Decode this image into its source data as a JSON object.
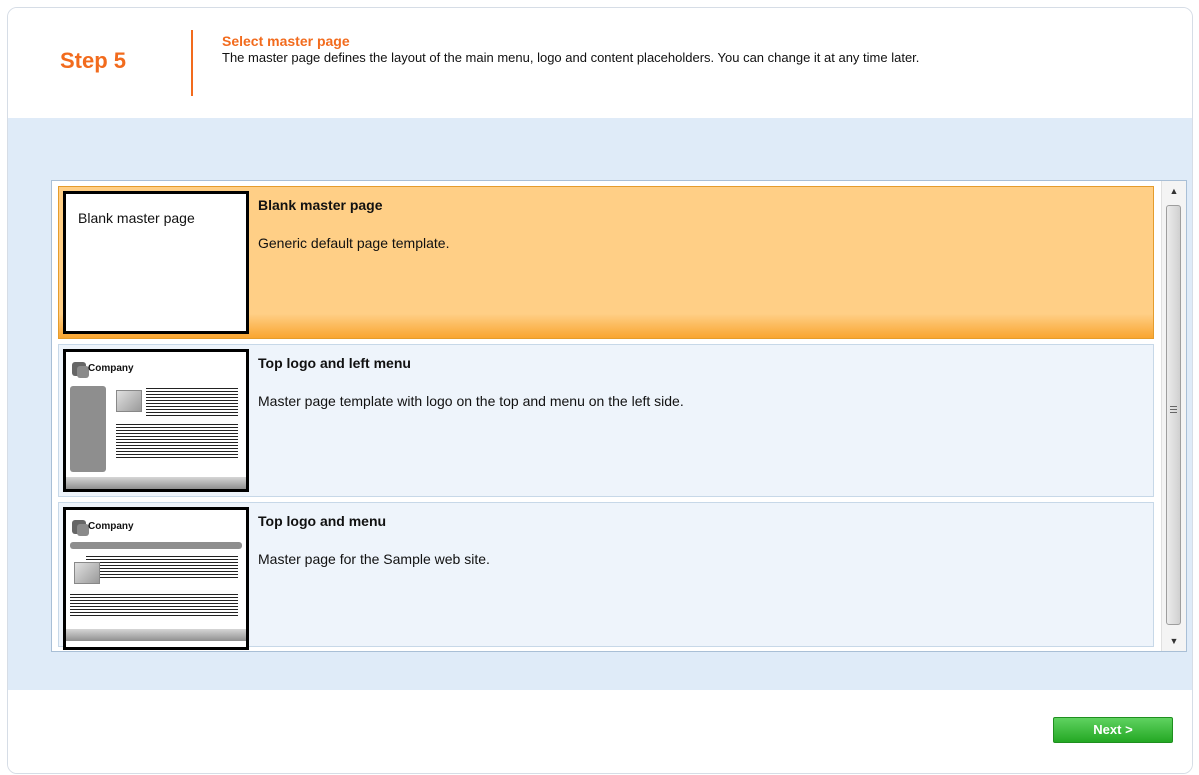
{
  "header": {
    "step": "Step 5",
    "title": "Select master page",
    "description": "The master page defines the layout of the main menu, logo and content placeholders. You can change it at any time later."
  },
  "items": [
    {
      "thumbnail_label": "Blank master page",
      "title": "Blank master page",
      "description": "Generic default page template.",
      "selected": true
    },
    {
      "thumbnail_company": "Company",
      "title": "Top logo and left menu",
      "description": "Master page template with logo on the top and menu on the left side.",
      "selected": false
    },
    {
      "thumbnail_company": "Company",
      "title": "Top logo and menu",
      "description": "Master page for the Sample web site.",
      "selected": false
    }
  ],
  "scrollbar": {
    "up_icon": "▲",
    "down_icon": "▼"
  },
  "footer": {
    "next_label": "Next >"
  },
  "colors": {
    "accent": "#f26b1d",
    "selected": "#ffcf86",
    "next": "#2eb42e",
    "content_bg": "#dfebf8"
  }
}
